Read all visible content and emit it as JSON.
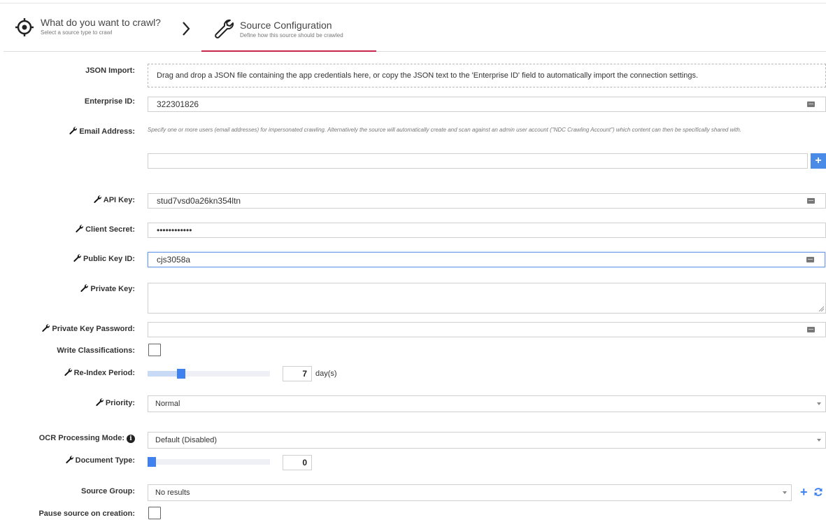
{
  "wizard": {
    "step1_title": "What do you want to crawl?",
    "step1_sub": "Select a source type to crawl",
    "step2_title": "Source Configuration",
    "step2_sub": "Define how this source should be crawled",
    "accent": "#c8264a"
  },
  "form": {
    "json_import": {
      "label": "JSON Import:",
      "text": "Drag and drop a JSON file containing the app credentials here, or copy the JSON text to the 'Enterprise ID' field to automatically import the connection settings."
    },
    "enterprise_id": {
      "label": "Enterprise ID:",
      "value": "322301826"
    },
    "email": {
      "label": "Email Address:",
      "hint": "Specify one or more users (email addresses) for impersonated crawling. Alternatively the source will automatically create and scan against an admin user account (\"NDC Crawling Account\") which content can then be specifically shared with.",
      "value": "",
      "add": "+"
    },
    "api_key": {
      "label": "API Key:",
      "value": "stud7vsd0a26kn354ltn"
    },
    "client_secret": {
      "label": "Client Secret:",
      "value": "••••••••••••"
    },
    "public_key_id": {
      "label": "Public Key ID:",
      "value": "cjs3058a"
    },
    "private_key": {
      "label": "Private Key:",
      "value": ""
    },
    "private_key_password": {
      "label": "Private Key Password:",
      "value": ""
    },
    "write_classifications": {
      "label": "Write Classifications:",
      "checked": false
    },
    "reindex_period": {
      "label": "Re-Index Period:",
      "value": "7",
      "unit": "day(s)",
      "slider_fraction": 0.26
    },
    "priority": {
      "label": "Priority:",
      "value": "Normal"
    },
    "ocr_mode": {
      "label": "OCR Processing Mode:",
      "info": "i",
      "value": "Default (Disabled)"
    },
    "document_type": {
      "label": "Document Type:",
      "value": "0",
      "slider_fraction": 0.0
    },
    "source_group": {
      "label": "Source Group:",
      "value": "No results",
      "add": "+"
    },
    "pause_on_creation": {
      "label": "Pause source on creation:",
      "checked": false
    }
  }
}
